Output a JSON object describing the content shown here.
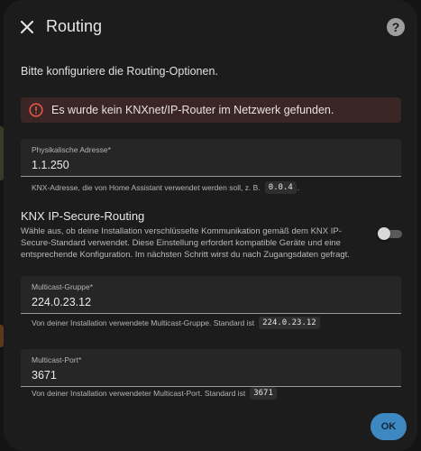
{
  "dialog": {
    "title": "Routing",
    "close_icon": "close-icon",
    "help_icon": "help-icon",
    "help_glyph": "?"
  },
  "intro": "Bitte konfiguriere die Routing-Optionen.",
  "alert": {
    "icon": "error-icon",
    "text": "Es wurde kein KNXnet/IP-Router im Netzwerk gefunden.",
    "color": "#e45649"
  },
  "physical_address": {
    "label": "Physikalische Adresse*",
    "value": "1.1.250",
    "helper": "KNX-Adresse, die von Home Assistant verwendet werden soll, z. B.",
    "helper_code": "0.0.4",
    "helper_suffix": "."
  },
  "secure_routing": {
    "title": "KNX IP-Secure-Routing",
    "description": "Wähle aus, ob deine Installation verschlüsselte Kommunikation gemäß dem KNX IP-Secure-Standard verwendet. Diese Einstellung erfordert kompatible Geräte und eine entsprechende Konfiguration. Im nächsten Schritt wirst du nach Zugangsdaten gefragt.",
    "enabled": false
  },
  "multicast_group": {
    "label": "Multicast-Gruppe*",
    "value": "224.0.23.12",
    "helper": "Von deiner Installation verwendete Multicast-Gruppe. Standard ist",
    "helper_code": "224.0.23.12"
  },
  "multicast_port": {
    "label": "Multicast-Port*",
    "value": "3671",
    "helper": "Von deiner Installation verwendeter Multicast-Port. Standard ist",
    "helper_code": "3671"
  },
  "actions": {
    "ok_label": "OK",
    "ok_color": "#3e88c1"
  }
}
